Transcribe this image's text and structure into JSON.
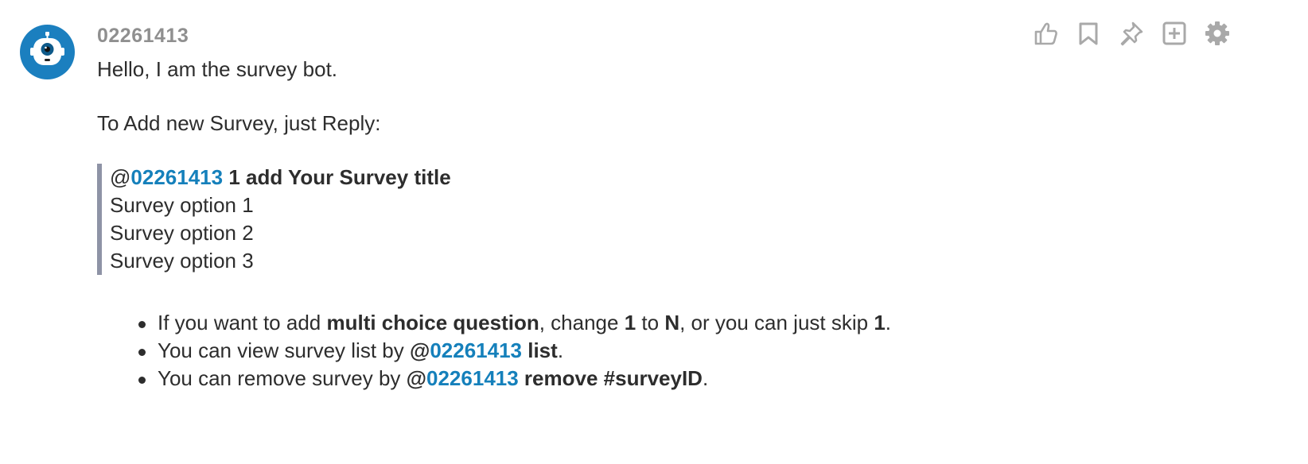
{
  "message": {
    "username": "02261413",
    "greeting": "Hello, I am the survey bot.",
    "instructions_intro": "To Add new Survey, just Reply:",
    "quote": {
      "at": "@",
      "mention": "02261413",
      "command": "1 add Your Survey title",
      "options": [
        "Survey option 1",
        "Survey option 2",
        "Survey option 3"
      ]
    },
    "bullets": {
      "b1": {
        "t1": "If you want to add ",
        "b1": "multi choice question",
        "t2": ", change ",
        "b2": "1",
        "t3": " to ",
        "b3": "N",
        "t4": ", or you can just skip ",
        "b4": "1",
        "t5": "."
      },
      "b2": {
        "t1": "You can view survey list by ",
        "at": "@",
        "mention": "02261413",
        "cmd": " list",
        "end": "."
      },
      "b3": {
        "t1": "You can remove survey by ",
        "at": "@",
        "mention": "02261413",
        "cmd": " remove #surveyID",
        "end": "."
      }
    }
  },
  "actions": [
    "thumbs-up-icon",
    "bookmark-icon",
    "pin-icon",
    "add-reaction-icon",
    "gear-icon"
  ],
  "colors": {
    "mention": "#1580bb",
    "avatar_bg": "#1b7fbf",
    "quote_border": "#8e93a6",
    "icon": "#a9a9a9",
    "username": "#8f8f8f"
  }
}
